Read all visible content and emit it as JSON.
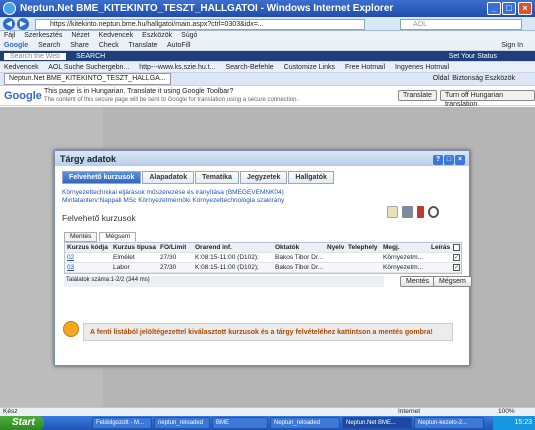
{
  "window": {
    "title": "Neptun.Net BME_KITEKINTO_TESZT_HALLGATOI - Windows Internet Explorer"
  },
  "address": {
    "url": "https://kitekinto.neptun.bme.hu/hallgatoi/main.aspx?ctrl=0303&idx=...",
    "search_placeholder": "AOL"
  },
  "menu": [
    "Fájl",
    "Szerkesztés",
    "Nézet",
    "Kedvencek",
    "Eszközök",
    "Súgó"
  ],
  "toolbar1": {
    "google": "Google",
    "search": "Search",
    "share": "Share",
    "check": "Check",
    "translate": "Translate",
    "autofill": "AutoFill",
    "signin": "Sign In"
  },
  "toolbar2": {
    "search_field": "Search the Web",
    "search_btn": "SEARCH",
    "settings": "Set Your Status"
  },
  "favorites": [
    "Kedvencek",
    "AOL Suche Suchergebn...",
    "http---www.ks.szie.hu.t...",
    "Search-Befehle",
    "Customize Links",
    "Free Hotmail",
    "Ingyenes Hotmail"
  ],
  "tab": {
    "label": "Neptun.Net BME_KITEKINTO_TESZT_HALLGA...",
    "page_menu": "Oldal",
    "security_menu": "Biztonság",
    "tools_menu": "Eszközök"
  },
  "gbar": {
    "logo": "Google",
    "msg": "This page is in Hungarian.  Translate it using Google Toolbar?",
    "msg2": "The content of this secure page will be sent to Google for translation using a secure connection.",
    "translate_btn": "Translate",
    "turnoff_btn": "Turn off Hungarian translation"
  },
  "dialog": {
    "title": "Tárgy adatok",
    "tabs": [
      "Felvehető kurzusok",
      "Alapadatok",
      "Tematika",
      "Jegyzetek",
      "Hallgatók"
    ],
    "subject_line1": "Környezettechnikai eljárások műszerezése és irányítása (BMEGEVEMNK04)",
    "subject_line2": "Mintatanterv:Nappali MSc Környezetmérnöki Környezettechnológia szakirány",
    "section_title": "Felvehető kurzusok",
    "subtabs": [
      "Mentés",
      "Mégsem"
    ],
    "columns": [
      "Kurzus kódja",
      "Kurzus típusa",
      "FŐ/Limit",
      "Órarend inf.",
      "Oktatók",
      "Nyelv",
      "Telephely",
      "Megj.",
      "Leírás"
    ],
    "rows": [
      {
        "code": "02",
        "type": "Elmélet",
        "limit": "27/30",
        "schedule": "K:08:15-11:00 (D102);",
        "teacher": "Bakos Tibor Dr...",
        "lang": "",
        "site": "",
        "note": "Környezetm...",
        "checked": true
      },
      {
        "code": "03",
        "type": "Labor",
        "limit": "27/30",
        "schedule": "K:08:15-11:00 (D102);",
        "teacher": "Bakos Tibor Dr...",
        "lang": "",
        "site": "",
        "note": "Környezetm...",
        "checked": true
      }
    ],
    "footer": "Találatok száma:1-2/2 (344 ms)",
    "save_btn": "Mentés",
    "cancel_btn": "Mégsem",
    "warning": "A fenti listából jelöltégezettel kiválasztott kurzusok és a tárgy felvételéhez kattintson a mentés gombra!"
  },
  "status": {
    "left": "Kész",
    "zone": "Internet",
    "zoom": "100%"
  },
  "taskbar": {
    "start": "Start",
    "items": [
      "Feldolgozott - M...",
      "neptun_reloaded",
      "BME",
      "Neptun_reloaded",
      "Neptun.Net BME...",
      "Neptun-kezelo-2..."
    ],
    "clock": "15:23"
  }
}
